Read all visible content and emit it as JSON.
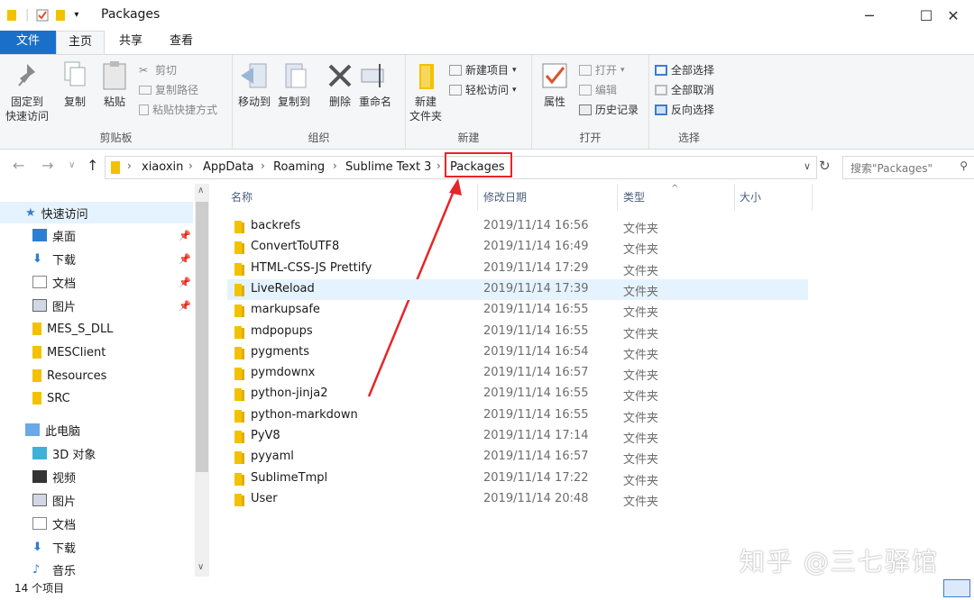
{
  "window": {
    "title": "Packages",
    "minimize_icon": "minimize-icon",
    "maximize_icon": "maximize-icon",
    "close_icon": "close-icon"
  },
  "tabs": {
    "file": "文件",
    "home": "主页",
    "share": "共享",
    "view": "查看"
  },
  "ribbon": {
    "clipboard": {
      "label": "剪贴板",
      "pin_quick_access": "固定到\n快速访问",
      "copy": "复制",
      "paste": "粘贴",
      "cut": "剪切",
      "copy_path": "复制路径",
      "paste_shortcut": "粘贴快捷方式"
    },
    "organize": {
      "label": "组织",
      "move_to": "移动到",
      "copy_to": "复制到",
      "delete": "删除",
      "rename": "重命名"
    },
    "new": {
      "label": "新建",
      "new_folder": "新建\n文件夹",
      "new_item": "新建项目",
      "easy_access": "轻松访问"
    },
    "open": {
      "label": "打开",
      "properties": "属性",
      "open": "打开",
      "edit": "编辑",
      "history": "历史记录"
    },
    "select": {
      "label": "选择",
      "select_all": "全部选择",
      "select_none": "全部取消",
      "invert": "反向选择"
    }
  },
  "address": {
    "crumbs": [
      "xiaoxin",
      "AppData",
      "Roaming",
      "Sublime Text 3",
      "Packages"
    ],
    "search_placeholder": "搜索\"Packages\""
  },
  "nav": {
    "quick_access": "快速访问",
    "items": [
      {
        "label": "桌面",
        "icon": "desktop-icon",
        "pinned": true
      },
      {
        "label": "下载",
        "icon": "download-icon",
        "pinned": true
      },
      {
        "label": "文档",
        "icon": "document-icon",
        "pinned": true
      },
      {
        "label": "图片",
        "icon": "pictures-icon",
        "pinned": true
      },
      {
        "label": "MES_S_DLL",
        "icon": "folder-icon",
        "pinned": false
      },
      {
        "label": "MESClient",
        "icon": "folder-icon",
        "pinned": false
      },
      {
        "label": "Resources",
        "icon": "folder-icon",
        "pinned": false
      },
      {
        "label": "SRC",
        "icon": "folder-icon",
        "pinned": false
      }
    ],
    "this_pc": "此电脑",
    "pc_items": [
      {
        "label": "3D 对象",
        "icon": "3d-objects-icon"
      },
      {
        "label": "视频",
        "icon": "video-icon"
      },
      {
        "label": "图片",
        "icon": "pictures-icon"
      },
      {
        "label": "文档",
        "icon": "document-icon"
      },
      {
        "label": "下载",
        "icon": "download-icon"
      },
      {
        "label": "音乐",
        "icon": "music-icon"
      }
    ]
  },
  "columns": {
    "name": "名称",
    "date": "修改日期",
    "type": "类型",
    "size": "大小"
  },
  "files": [
    {
      "name": "backrefs",
      "date": "2019/11/14 16:56",
      "type": "文件夹"
    },
    {
      "name": "ConvertToUTF8",
      "date": "2019/11/14 16:49",
      "type": "文件夹"
    },
    {
      "name": "HTML-CSS-JS Prettify",
      "date": "2019/11/14 17:29",
      "type": "文件夹"
    },
    {
      "name": "LiveReload",
      "date": "2019/11/14 17:39",
      "type": "文件夹",
      "selected": true
    },
    {
      "name": "markupsafe",
      "date": "2019/11/14 16:55",
      "type": "文件夹"
    },
    {
      "name": "mdpopups",
      "date": "2019/11/14 16:55",
      "type": "文件夹"
    },
    {
      "name": "pygments",
      "date": "2019/11/14 16:54",
      "type": "文件夹"
    },
    {
      "name": "pymdownx",
      "date": "2019/11/14 16:57",
      "type": "文件夹"
    },
    {
      "name": "python-jinja2",
      "date": "2019/11/14 16:55",
      "type": "文件夹"
    },
    {
      "name": "python-markdown",
      "date": "2019/11/14 16:55",
      "type": "文件夹"
    },
    {
      "name": "PyV8",
      "date": "2019/11/14 17:14",
      "type": "文件夹"
    },
    {
      "name": "pyyaml",
      "date": "2019/11/14 16:57",
      "type": "文件夹"
    },
    {
      "name": "SublimeTmpl",
      "date": "2019/11/14 17:22",
      "type": "文件夹"
    },
    {
      "name": "User",
      "date": "2019/11/14 20:48",
      "type": "文件夹"
    }
  ],
  "status": {
    "count": "14 个项目"
  },
  "watermark": "知乎 @三七驿馆",
  "colors": {
    "accent": "#1a70c9",
    "highlight": "#e5252a",
    "folder": "#f2c200",
    "selected_row": "#e5f3ff"
  }
}
